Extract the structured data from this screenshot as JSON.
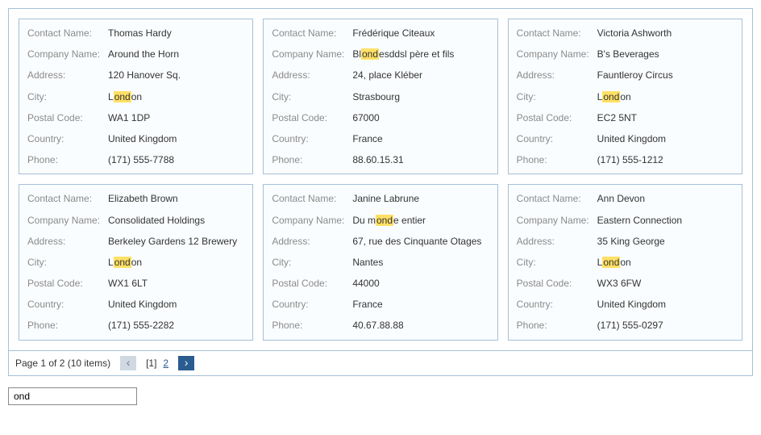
{
  "search_term": "ond",
  "labels": {
    "contact": "Contact Name:",
    "company": "Company Name:",
    "address": "Address:",
    "city": "City:",
    "postal": "Postal Code:",
    "country": "Country:",
    "phone": "Phone:"
  },
  "cards": [
    {
      "contact": "Thomas Hardy",
      "company": "Around the Horn",
      "address": "120 Hanover Sq.",
      "city": "London",
      "postal": "WA1 1DP",
      "country": "United Kingdom",
      "phone": "(171) 555-7788"
    },
    {
      "contact": "Frédérique Citeaux",
      "company": "Blondesddsl père et fils",
      "address": "24, place Kléber",
      "city": "Strasbourg",
      "postal": "67000",
      "country": "France",
      "phone": "88.60.15.31"
    },
    {
      "contact": "Victoria Ashworth",
      "company": "B's Beverages",
      "address": "Fauntleroy Circus",
      "city": "London",
      "postal": "EC2 5NT",
      "country": "United Kingdom",
      "phone": "(171) 555-1212"
    },
    {
      "contact": "Elizabeth Brown",
      "company": "Consolidated Holdings",
      "address": "Berkeley Gardens 12 Brewery",
      "city": "London",
      "postal": "WX1 6LT",
      "country": "United Kingdom",
      "phone": "(171) 555-2282"
    },
    {
      "contact": "Janine Labrune",
      "company": "Du monde entier",
      "address": "67, rue des Cinquante Otages",
      "city": "Nantes",
      "postal": "44000",
      "country": "France",
      "phone": "40.67.88.88"
    },
    {
      "contact": "Ann Devon",
      "company": "Eastern Connection",
      "address": "35 King George",
      "city": "London",
      "postal": "WX3 6FW",
      "country": "United Kingdom",
      "phone": "(171) 555-0297"
    }
  ],
  "pager": {
    "status": "Page 1 of 2 (10 items)",
    "pages": [
      "1",
      "2"
    ],
    "current": 1
  },
  "field_order": [
    "contact",
    "company",
    "address",
    "city",
    "postal",
    "country",
    "phone"
  ]
}
